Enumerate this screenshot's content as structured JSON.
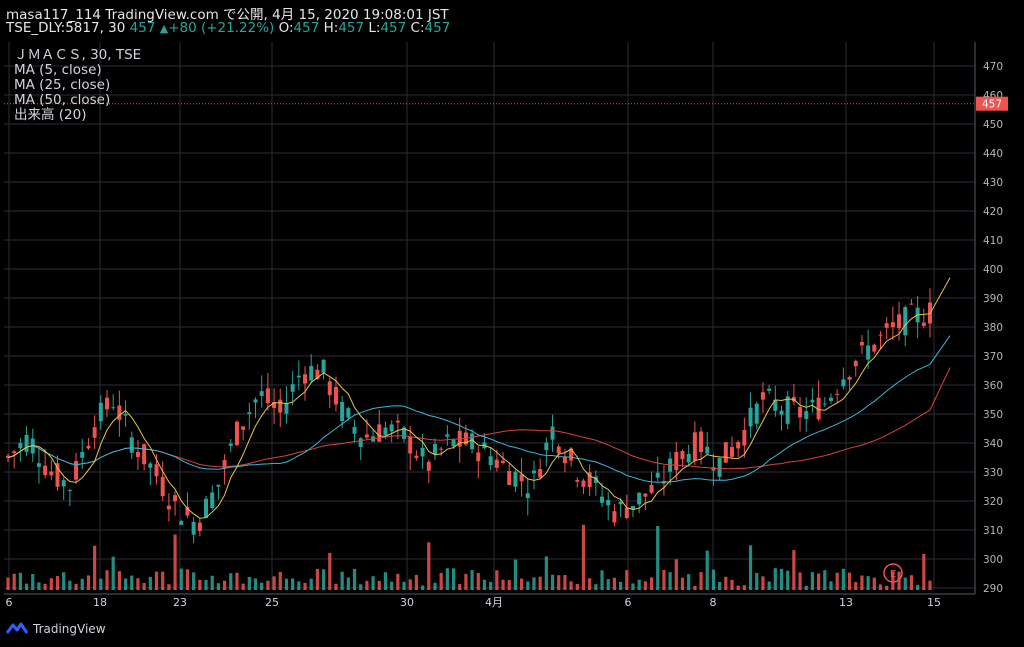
{
  "header": {
    "publish_line": "masa117_114 TradingView.com で公開, 4月 15, 2020 19:08:01 JST",
    "symbol": "TSE_DLY:5817, 30",
    "last": "457",
    "change_arrow_icon": "up-triangle-icon",
    "change": "+80 (+21.22%)",
    "o_label": "O:",
    "o_value": "457",
    "h_label": "H:",
    "h_value": "457",
    "l_label": "L:",
    "l_value": "457",
    "c_label": "C:",
    "c_value": "457"
  },
  "indicators": {
    "title": "ＪＭＡＣＳ, 30, TSE",
    "ma5": "MA (5, close)",
    "ma25": "MA (25, close)",
    "ma50": "MA (50, close)",
    "volume": "出来高 (20)"
  },
  "footer": {
    "logo_icon": "tradingview-logo-icon",
    "brand": "TradingView"
  },
  "chart_data": {
    "type": "candlestick",
    "yticks": [
      290,
      300,
      310,
      320,
      330,
      340,
      350,
      360,
      370,
      380,
      390,
      400,
      410,
      420,
      430,
      440,
      450,
      460,
      470
    ],
    "ylim": [
      285,
      475
    ],
    "xticks": [
      "6",
      "18",
      "23",
      "25",
      "30",
      "4月",
      "6",
      "8",
      "13",
      "15"
    ],
    "price_label": "457",
    "event_marker": "E",
    "colors": {
      "up": "#26a69a",
      "down": "#ef5350",
      "ma5": "#e8c646",
      "ma25": "#3cb6d6",
      "ma50": "#d9433d",
      "grid": "#2a2e39",
      "priceline": "#ef5350"
    },
    "approx_close_series": [
      {
        "x": 0.0,
        "v": 335
      },
      {
        "x": 0.5,
        "v": 342
      },
      {
        "x": 1.0,
        "v": 330
      },
      {
        "x": 1.5,
        "v": 325
      },
      {
        "x": 2.0,
        "v": 345
      },
      {
        "x": 2.5,
        "v": 355
      },
      {
        "x": 3.0,
        "v": 340
      },
      {
        "x": 3.5,
        "v": 330
      },
      {
        "x": 4.0,
        "v": 318
      },
      {
        "x": 4.5,
        "v": 312
      },
      {
        "x": 5.0,
        "v": 325
      },
      {
        "x": 5.5,
        "v": 345
      },
      {
        "x": 6.0,
        "v": 357
      },
      {
        "x": 6.5,
        "v": 350
      },
      {
        "x": 7.0,
        "v": 365
      },
      {
        "x": 7.5,
        "v": 365
      },
      {
        "x": 8.0,
        "v": 350
      },
      {
        "x": 8.5,
        "v": 342
      },
      {
        "x": 9.0,
        "v": 345
      },
      {
        "x": 9.5,
        "v": 342
      },
      {
        "x": 10.0,
        "v": 332
      },
      {
        "x": 10.5,
        "v": 340
      },
      {
        "x": 11.0,
        "v": 340
      },
      {
        "x": 11.5,
        "v": 336
      },
      {
        "x": 12.0,
        "v": 330
      },
      {
        "x": 12.5,
        "v": 325
      },
      {
        "x": 13.0,
        "v": 345
      },
      {
        "x": 13.5,
        "v": 332
      },
      {
        "x": 14.0,
        "v": 325
      },
      {
        "x": 14.5,
        "v": 316
      },
      {
        "x": 15.0,
        "v": 320
      },
      {
        "x": 15.5,
        "v": 325
      },
      {
        "x": 16.0,
        "v": 335
      },
      {
        "x": 16.5,
        "v": 340
      },
      {
        "x": 17.0,
        "v": 333
      },
      {
        "x": 17.5,
        "v": 342
      },
      {
        "x": 18.0,
        "v": 355
      },
      {
        "x": 18.5,
        "v": 352
      },
      {
        "x": 19.0,
        "v": 350
      },
      {
        "x": 19.5,
        "v": 354
      },
      {
        "x": 20.0,
        "v": 365
      },
      {
        "x": 20.5,
        "v": 372
      },
      {
        "x": 21.0,
        "v": 378
      },
      {
        "x": 21.5,
        "v": 383
      },
      {
        "x": 22.0,
        "v": 385
      },
      {
        "x": 22.5,
        "v": 397
      }
    ]
  }
}
